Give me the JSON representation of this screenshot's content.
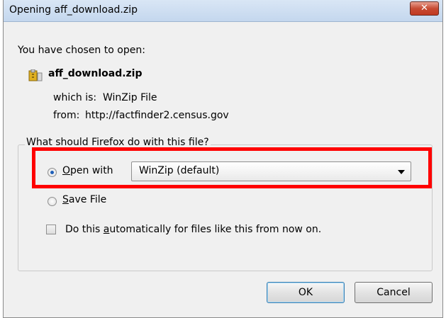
{
  "window": {
    "title": "Opening aff_download.zip",
    "close_label": "✕"
  },
  "intro": {
    "chosen_label": "You have chosen to open:"
  },
  "file": {
    "name": "aff_download.zip",
    "which_label": "which is:",
    "which_value": "WinZip File",
    "from_label": "from:",
    "from_value": "http://factfinder2.census.gov"
  },
  "action": {
    "question": "What should Firefox do with this file?",
    "open_with_label_u": "O",
    "open_with_label_rest": "pen with",
    "open_with_app": "WinZip (default)",
    "save_file_label_u": "S",
    "save_file_label_rest": "ave File",
    "auto_label_pre": "Do this ",
    "auto_label_u": "a",
    "auto_label_post": "utomatically for files like this from now on.",
    "selected": "open_with",
    "auto_checked": false
  },
  "buttons": {
    "ok": "OK",
    "cancel": "Cancel"
  },
  "colors": {
    "highlight": "#ff0000",
    "radio_dot": "#1f5fb8"
  }
}
